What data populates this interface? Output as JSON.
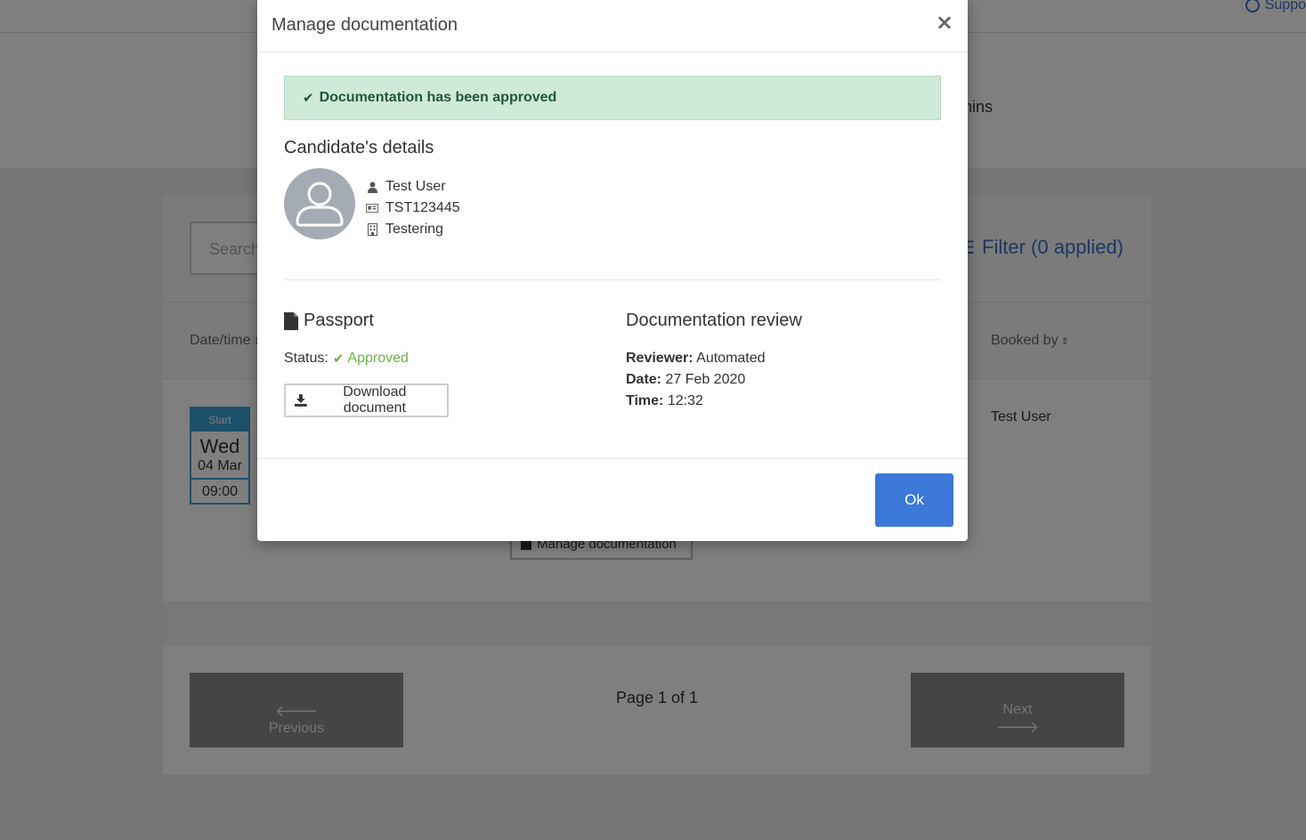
{
  "background": {
    "support_label": "Suppo",
    "hero_tab_fragment": "nins",
    "search_placeholder": "Search",
    "filter_label": "Filter (0 applied)",
    "table_headers": {
      "date_time": "Date/time",
      "booked_by": "Booked by"
    },
    "row": {
      "start_label": "Start",
      "day": "Wed",
      "date": "04 Mar",
      "time": "09:00",
      "booked_by": "Test User",
      "manage_button": "Manage documentation"
    },
    "pager": {
      "previous_label": "Previous",
      "next_label": "Next",
      "page_info": "Page 1 of 1"
    }
  },
  "modal": {
    "title": "Manage documentation",
    "close_glyph": "×",
    "alert_text": "Documentation has been approved",
    "candidate": {
      "heading": "Candidate's details",
      "name": "Test User",
      "id": "TST123445",
      "organisation": "Testering"
    },
    "passport": {
      "heading": "Passport",
      "status_label": "Status:",
      "status_value": "Approved",
      "download_label": "Download document"
    },
    "review": {
      "heading": "Documentation review",
      "reviewer_label": "Reviewer:",
      "reviewer_value": "Automated",
      "date_label": "Date:",
      "date_value": "27 Feb 2020",
      "time_label": "Time:",
      "time_value": "12:32"
    },
    "ok_label": "Ok"
  },
  "colors": {
    "primary": "#3c78d8",
    "success_bg": "#cfead8",
    "success_text": "#1f5a32",
    "approved": "#6cb33f",
    "date_badge": "#3aa0d4"
  }
}
